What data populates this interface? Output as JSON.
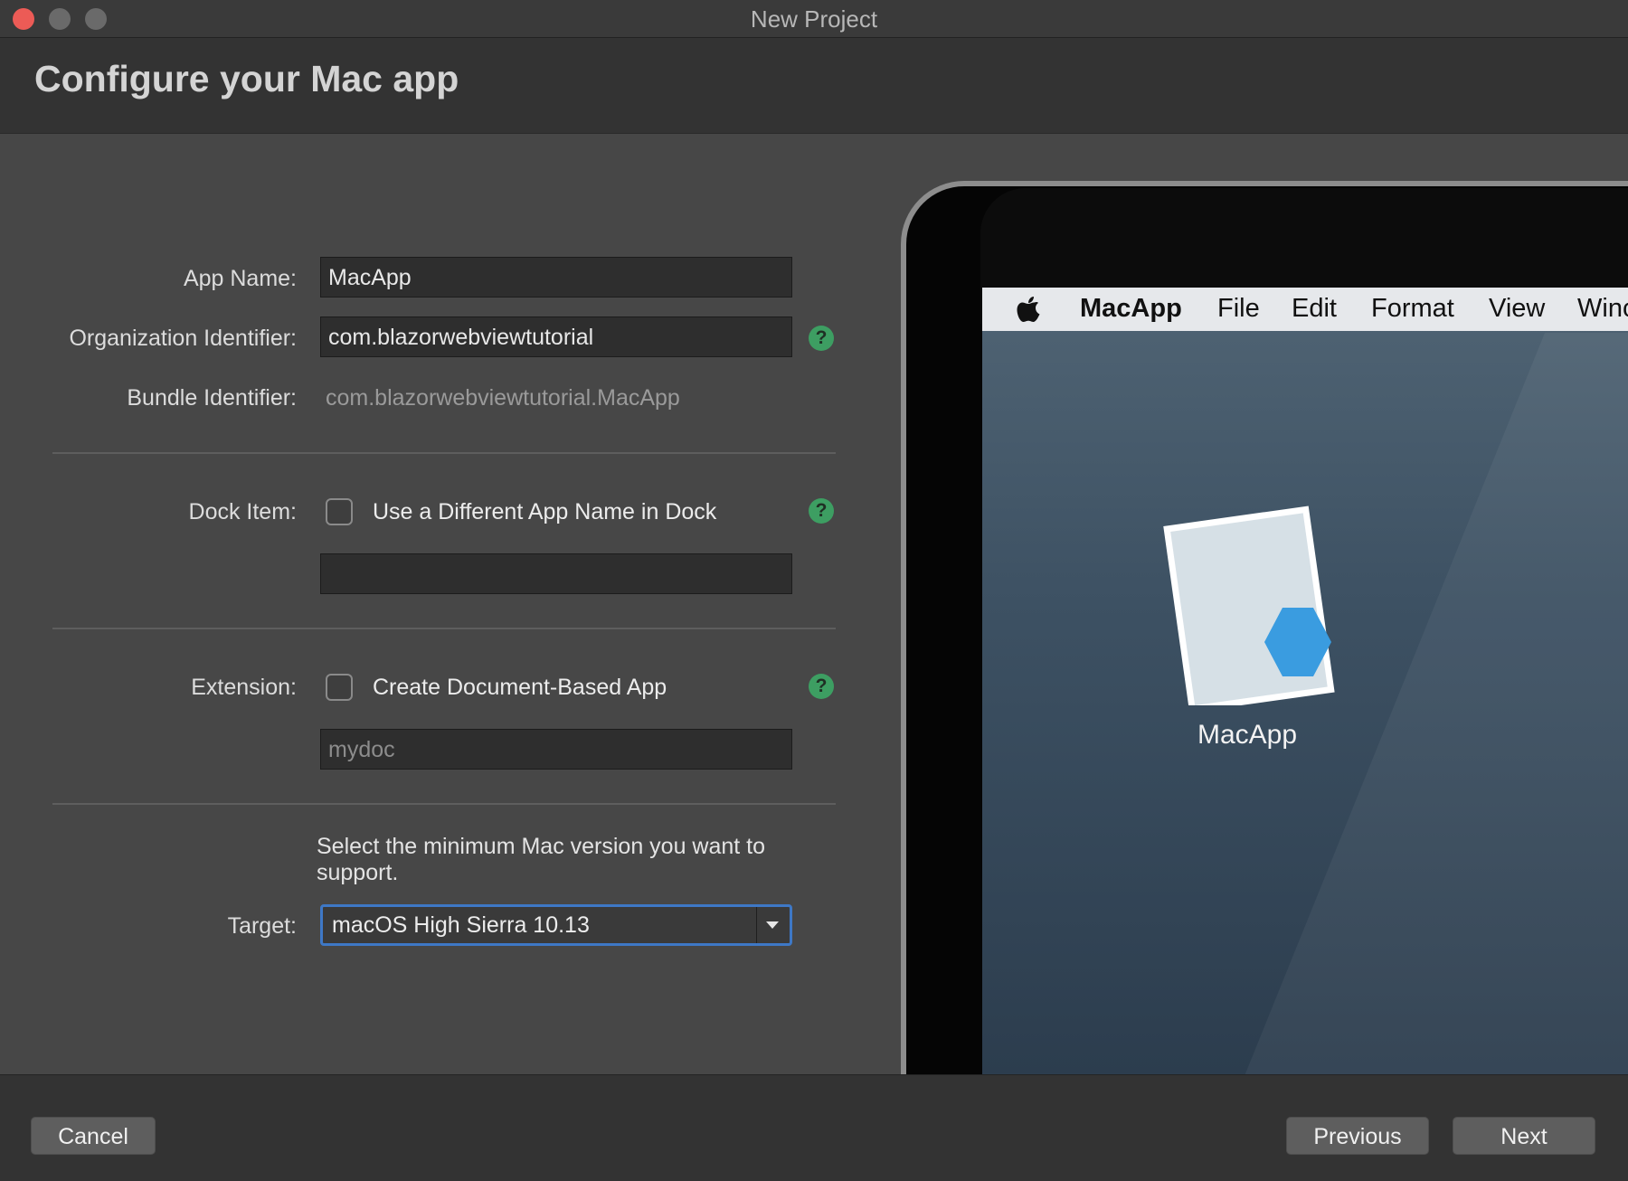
{
  "window": {
    "title": "New Project"
  },
  "header": {
    "title": "Configure your Mac app"
  },
  "form": {
    "app_name_label": "App Name:",
    "app_name_value": "MacApp",
    "org_id_label": "Organization Identifier:",
    "org_id_value": "com.blazorwebviewtutorial",
    "bundle_id_label": "Bundle Identifier:",
    "bundle_id_value": "com.blazorwebviewtutorial.MacApp",
    "dock_label": "Dock Item:",
    "dock_checkbox_label": "Use a Different App Name in Dock",
    "dock_checked": false,
    "dock_name_value": "",
    "extension_label": "Extension:",
    "extension_checkbox_label": "Create Document-Based App",
    "extension_checked": false,
    "extension_value": "mydoc",
    "target_description": "Select the minimum Mac version you want to support.",
    "target_label": "Target:",
    "target_value": "macOS High Sierra 10.13",
    "help_glyph": "?"
  },
  "preview": {
    "menu_items": [
      "MacApp",
      "File",
      "Edit",
      "Format",
      "View",
      "Winc"
    ],
    "app_caption": "MacApp",
    "icon_color": "#3a9ce0"
  },
  "footer": {
    "cancel_label": "Cancel",
    "previous_label": "Previous",
    "next_label": "Next"
  }
}
